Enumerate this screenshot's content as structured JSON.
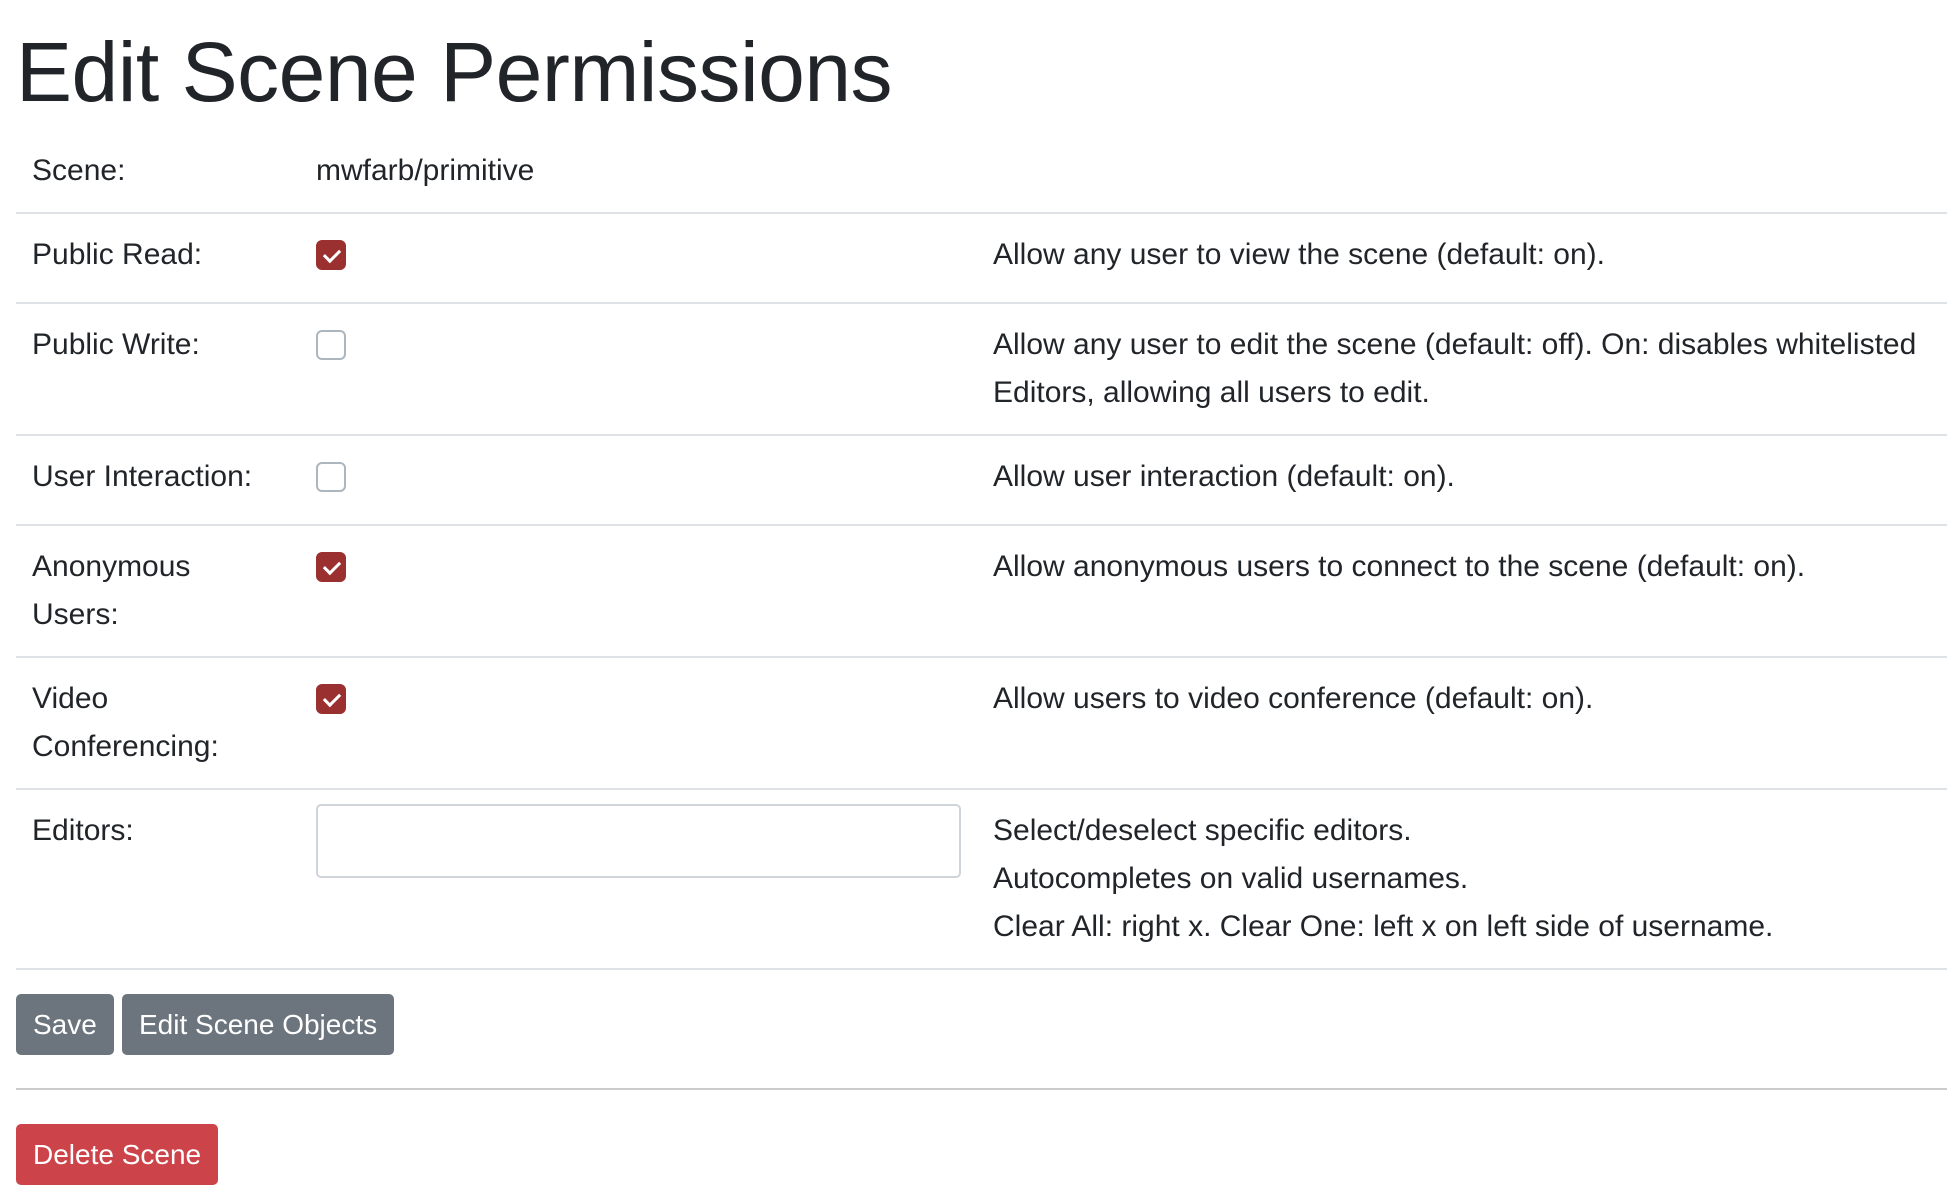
{
  "page_title": "Edit Scene Permissions",
  "rows": [
    {
      "label": "Scene:",
      "value": "mwfarb/primitive"
    },
    {
      "label": "Public Read:",
      "checked": true,
      "description": "Allow any user to view the scene (default: on)."
    },
    {
      "label": "Public Write:",
      "checked": false,
      "description": "Allow any user to edit the scene (default: off). On: disables whitelisted Editors, allowing all users to edit."
    },
    {
      "label": "User Interaction:",
      "checked": false,
      "description": "Allow user interaction (default: on)."
    },
    {
      "label": "Anonymous Users:",
      "checked": true,
      "description": "Allow anonymous users to connect to the scene (default: on)."
    },
    {
      "label": "Video Conferencing:",
      "checked": true,
      "description": "Allow users to video conference (default: on)."
    },
    {
      "label": "Editors:",
      "input_value": "",
      "description_lines": [
        "Select/deselect specific editors.",
        "Autocompletes on valid usernames.",
        "Clear All: right x. Clear One: left x on left side of username."
      ]
    }
  ],
  "buttons": {
    "save": "Save",
    "edit_objects": "Edit Scene Objects",
    "delete": "Delete Scene"
  },
  "colors": {
    "checkbox_checked": "#9b3030",
    "secondary_button": "#6c757d",
    "danger_button": "#cc434a"
  }
}
